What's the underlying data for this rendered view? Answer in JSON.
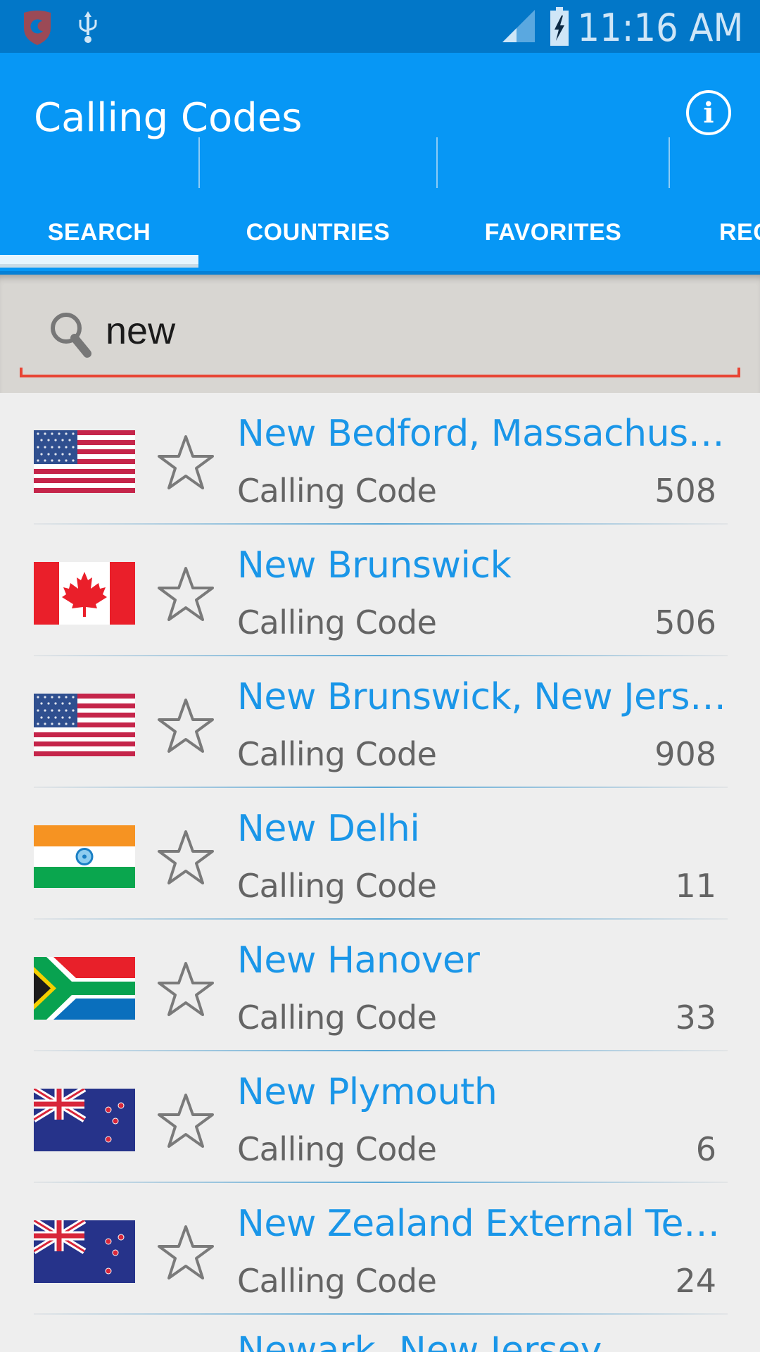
{
  "status_bar": {
    "time": "11:16 AM",
    "icons": [
      "shield-app-icon",
      "usb-icon",
      "signal-icon",
      "battery-charging-icon"
    ]
  },
  "app_bar": {
    "title": "Calling Codes",
    "info_icon": "info-icon",
    "info_glyph": "i"
  },
  "tabs": [
    {
      "label": "SEARCH",
      "selected": true
    },
    {
      "label": "COUNTRIES",
      "selected": false
    },
    {
      "label": "FAVORITES",
      "selected": false
    },
    {
      "label": "REC",
      "selected": false
    }
  ],
  "search": {
    "value": "new",
    "icon": "search-icon"
  },
  "results": [
    {
      "name": "New Bedford, Massachuse...",
      "label": "Calling Code",
      "code": "508",
      "flag": "us",
      "favorite": false
    },
    {
      "name": "New Brunswick",
      "label": "Calling Code",
      "code": "506",
      "flag": "ca",
      "favorite": false
    },
    {
      "name": "New Brunswick, New Jersey",
      "label": "Calling Code",
      "code": "908",
      "flag": "us",
      "favorite": false
    },
    {
      "name": "New Delhi",
      "label": "Calling Code",
      "code": "11",
      "flag": "in",
      "favorite": false
    },
    {
      "name": "New Hanover",
      "label": "Calling Code",
      "code": "33",
      "flag": "za",
      "favorite": false
    },
    {
      "name": "New Plymouth",
      "label": "Calling Code",
      "code": "6",
      "flag": "nz",
      "favorite": false
    },
    {
      "name": "New Zealand External Territ...",
      "label": "Calling Code",
      "code": "24",
      "flag": "nz",
      "favorite": false
    }
  ],
  "partial_next_item": "Newark, New Jersey",
  "colors": {
    "status_bar": "#0277c8",
    "app_bar": "#0797f5",
    "accent_text": "#1a96e8",
    "search_underline": "#e84434",
    "background": "#eeeeee"
  }
}
